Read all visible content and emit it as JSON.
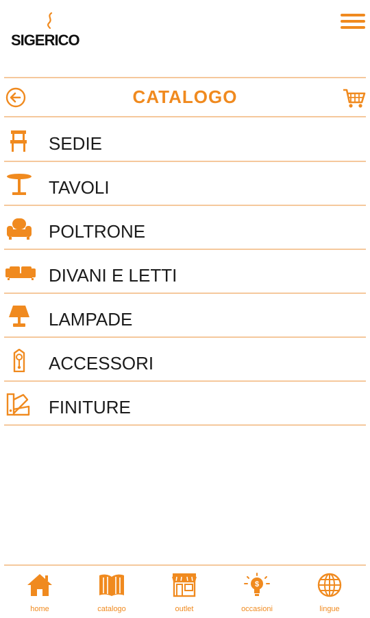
{
  "app": {
    "logo_text": "SIGERICO"
  },
  "header": {
    "title": "CATALOGO"
  },
  "menu": [
    {
      "label": "SEDIE",
      "icon": "chair-icon"
    },
    {
      "label": "TAVOLI",
      "icon": "table-icon"
    },
    {
      "label": "POLTRONE",
      "icon": "armchair-icon"
    },
    {
      "label": "DIVANI E LETTI",
      "icon": "sofa-icon"
    },
    {
      "label": "LAMPADE",
      "icon": "lamp-icon"
    },
    {
      "label": "ACCESSORI",
      "icon": "clock-icon"
    },
    {
      "label": "FINITURE",
      "icon": "swatch-icon"
    }
  ],
  "bottom_nav": [
    {
      "label": "home",
      "icon": "home-icon"
    },
    {
      "label": "catalogo",
      "icon": "book-icon"
    },
    {
      "label": "outlet",
      "icon": "store-icon"
    },
    {
      "label": "occasioni",
      "icon": "lightbulb-icon"
    },
    {
      "label": "lingue",
      "icon": "globe-icon"
    }
  ],
  "colors": {
    "accent": "#f08a1f",
    "divider": "#f5c89c",
    "text": "#1b1b1b"
  }
}
